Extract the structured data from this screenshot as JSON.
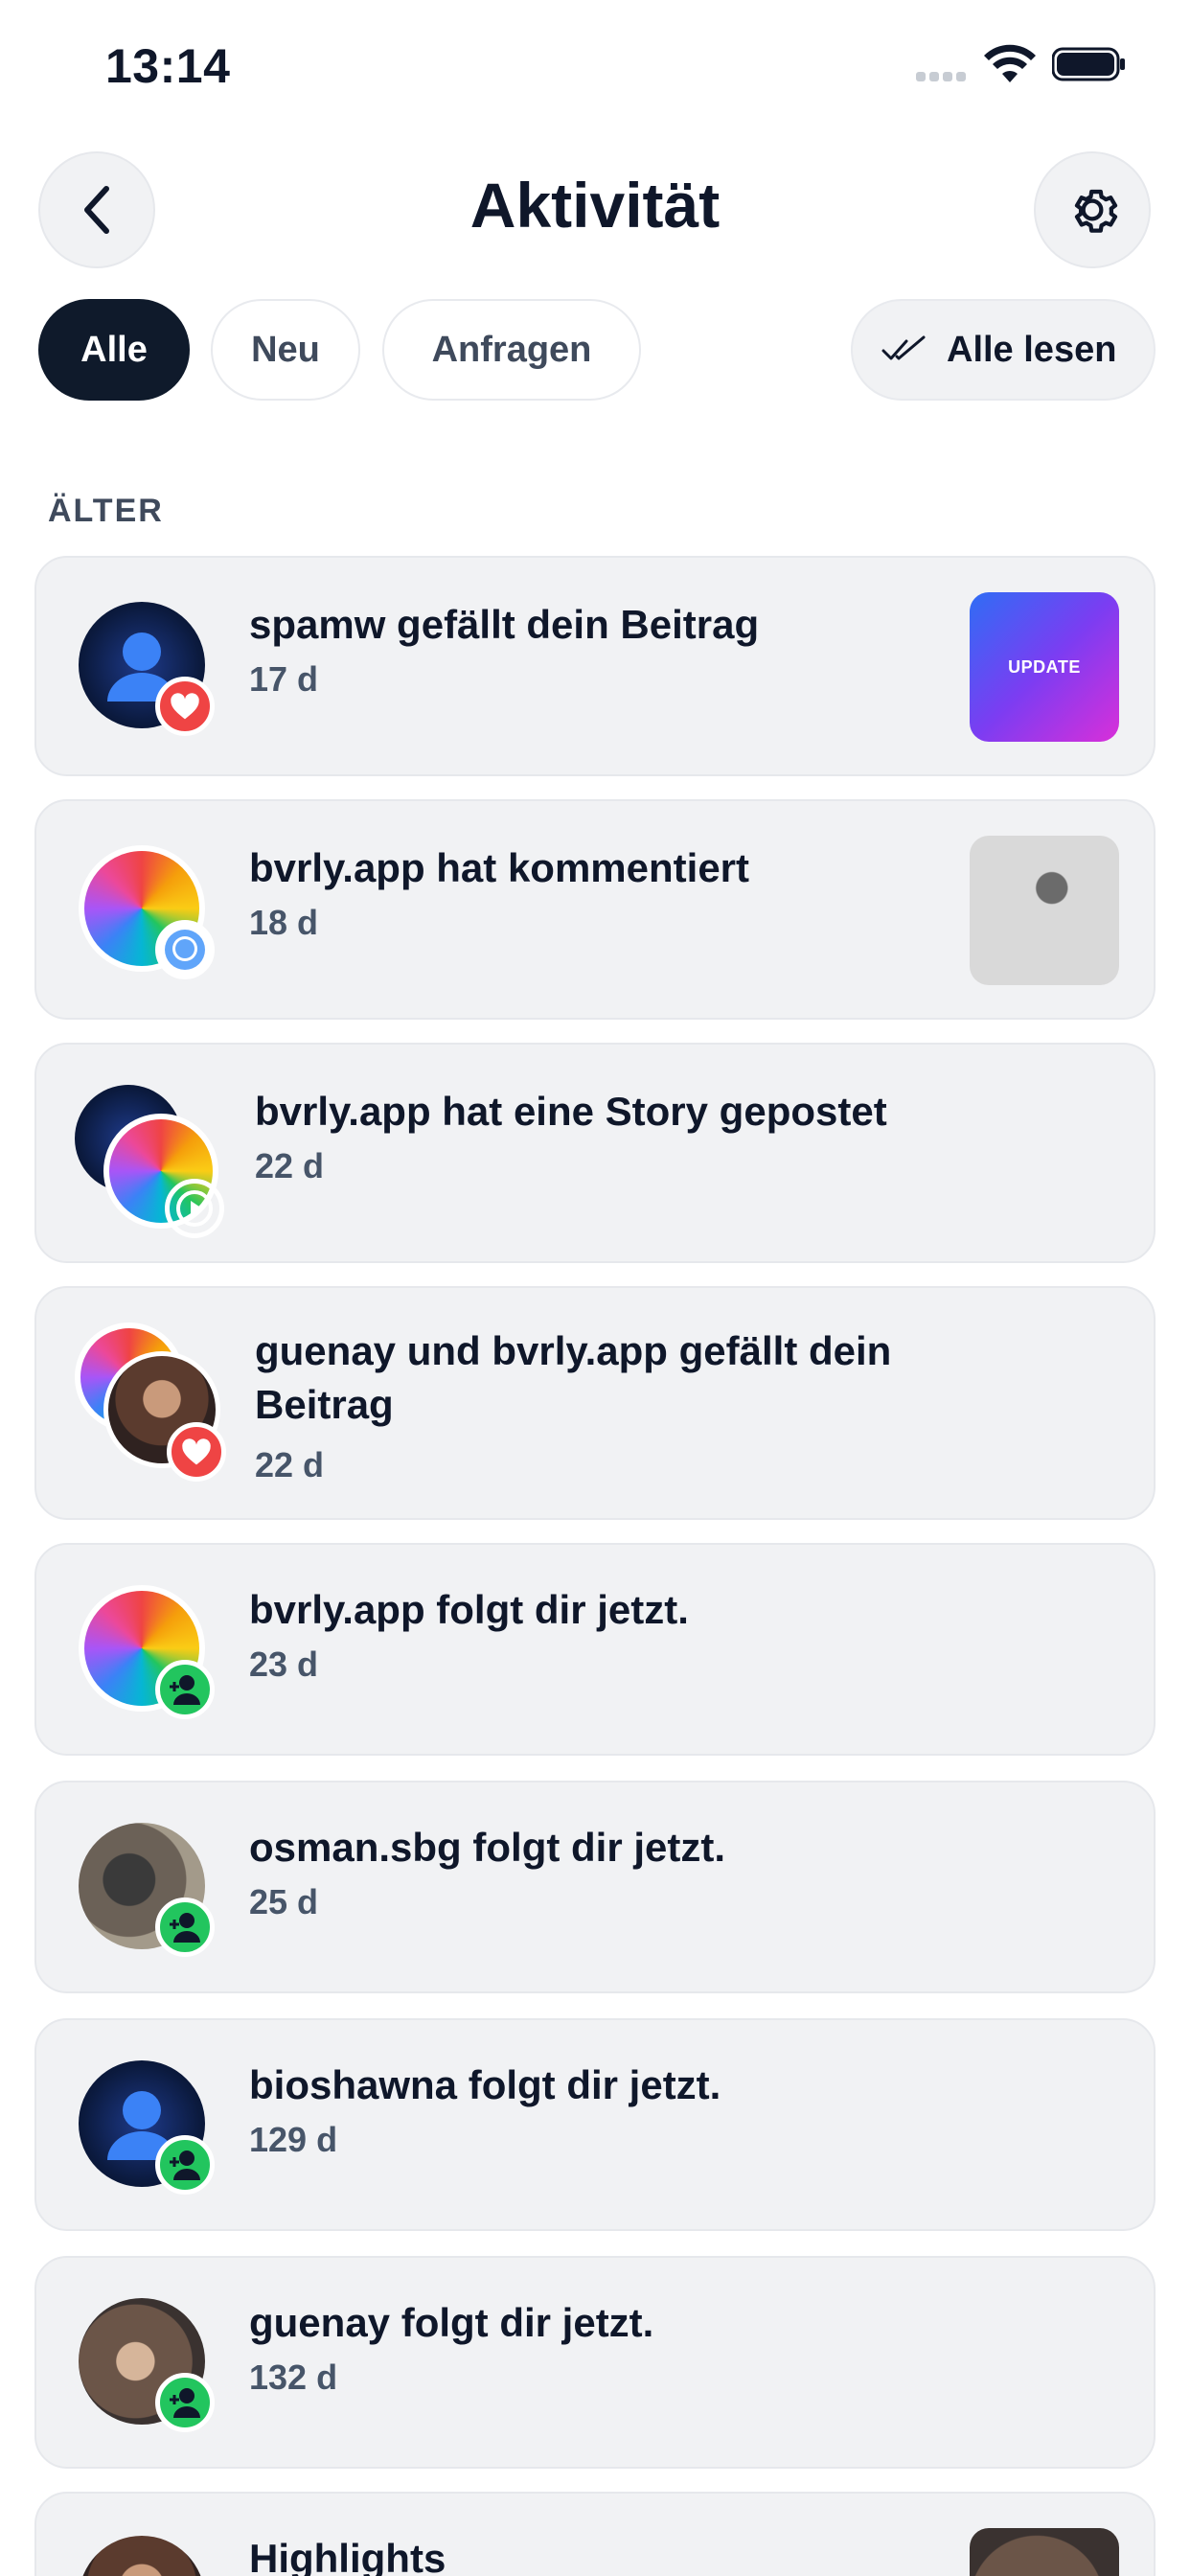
{
  "status_bar": {
    "time": "13:14"
  },
  "header": {
    "title": "Aktivität"
  },
  "filters": {
    "all": "Alle",
    "new": "Neu",
    "requests": "Anfragen",
    "read_all": "Alle lesen"
  },
  "section": {
    "label": "ÄLTER"
  },
  "items": [
    {
      "title": "spamw gefällt dein Beitrag",
      "time": "17 d",
      "badge": "like",
      "thumb_text": "UPDATE"
    },
    {
      "title": "bvrly.app hat kommentiert",
      "time": "18 d",
      "badge": "comment"
    },
    {
      "title": "bvrly.app hat eine Story gepostet",
      "time": "22 d",
      "badge": "story"
    },
    {
      "title": "guenay und bvrly.app gefällt dein",
      "title_line2": "Beitrag",
      "time": "22 d",
      "badge": "like"
    },
    {
      "title": "bvrly.app folgt dir jetzt.",
      "time": "23 d",
      "badge": "follow"
    },
    {
      "title": "osman.sbg folgt dir jetzt.",
      "time": "25 d",
      "badge": "follow"
    },
    {
      "title": "bioshawna folgt dir jetzt.",
      "time": "129 d",
      "badge": "follow"
    },
    {
      "title": "guenay folgt dir jetzt.",
      "time": "132 d",
      "badge": "follow"
    },
    {
      "title": "Highlights"
    }
  ],
  "colors": {
    "like": "#ef4444",
    "follow": "#22c55e",
    "comment": "#60a5fa",
    "card_bg": "#f1f2f4",
    "active_chip": "#0f1a2b"
  }
}
